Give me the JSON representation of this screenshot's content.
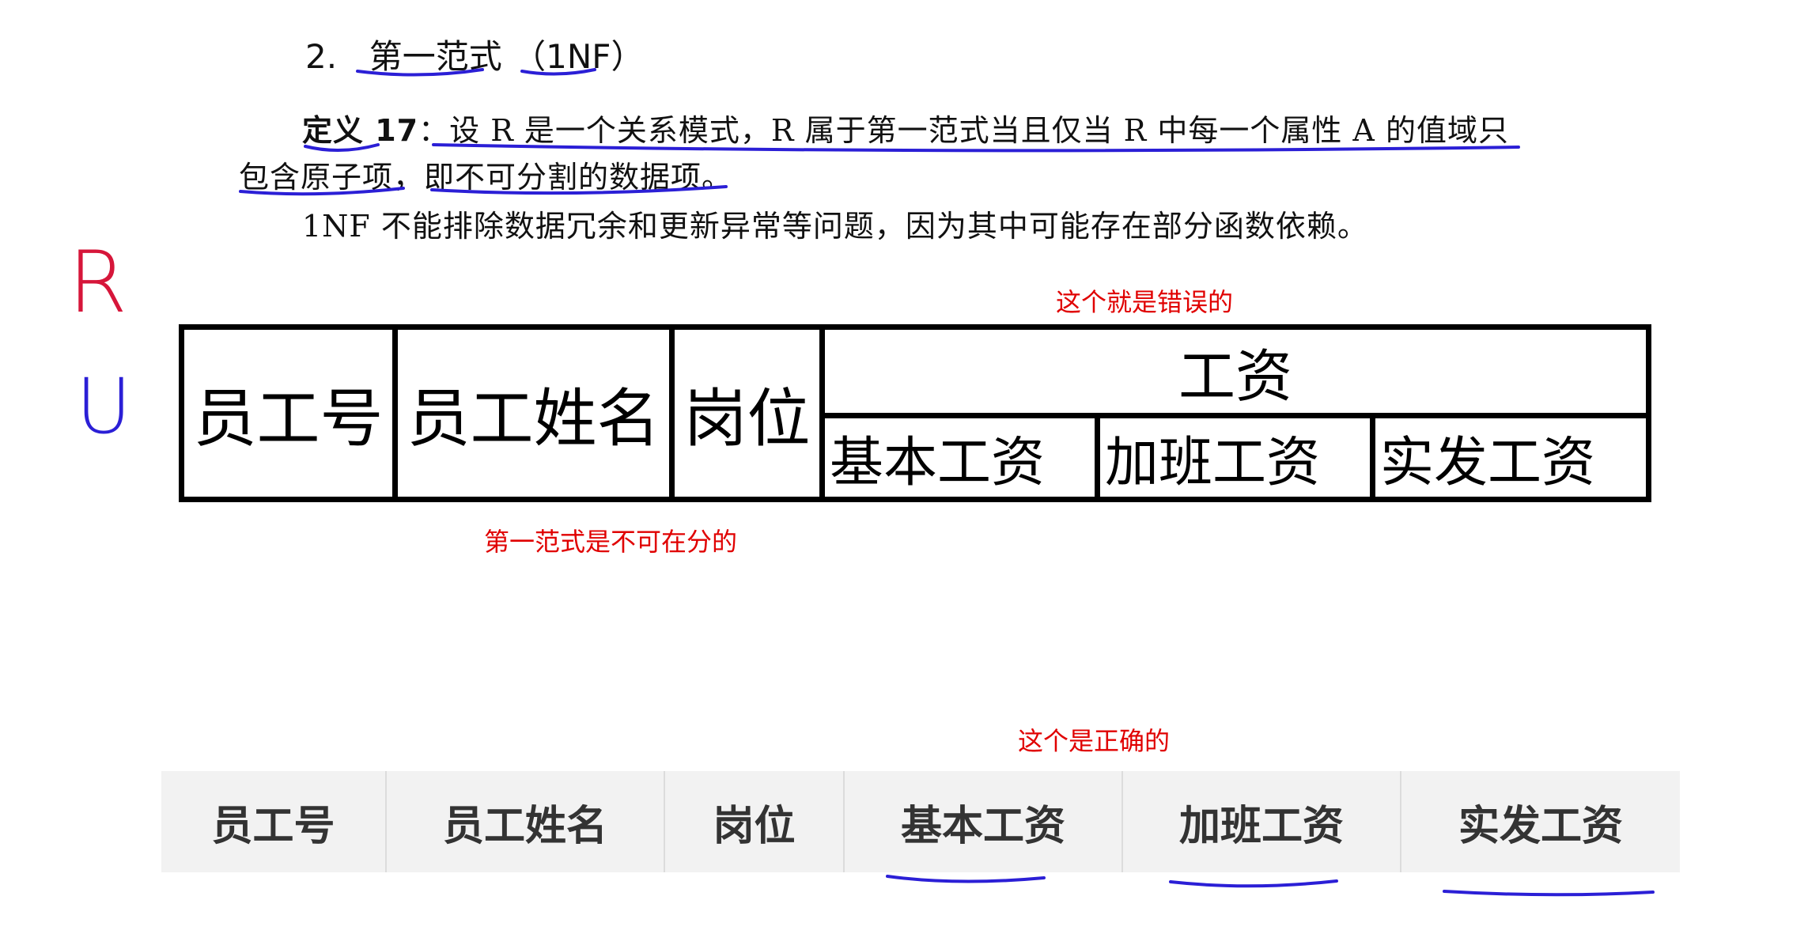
{
  "section": {
    "number": "2.",
    "title": "第一范式",
    "paren": "（1NF）"
  },
  "definition": {
    "label": "定义 17",
    "line1": "：设 R 是一个关系模式，R 属于第一范式当且仅当 R 中每一个属性 A 的值域只",
    "line2": "包含原子项，即不可分割的数据项。",
    "line3": "1NF 不能排除数据冗余和更新异常等问题，因为其中可能存在部分函数依赖。"
  },
  "handwritten": {
    "letter_r": "R",
    "letter_u": "U",
    "ink_color": "#2b1fd6",
    "r_color": "#d6163a"
  },
  "notes": {
    "wrong": "这个就是错误的",
    "atomic": "第一范式是不可在分的",
    "correct": "这个是正确的",
    "color": "#e00000"
  },
  "wrong_table": {
    "col1": "员工号",
    "col2": "员工姓名",
    "col3": "岗位",
    "group": "工资",
    "sub1": "基本工资",
    "sub2": "加班工资",
    "sub3": "实发工资"
  },
  "correct_table": {
    "headers": [
      "员工号",
      "员工姓名",
      "岗位",
      "基本工资",
      "加班工资",
      "实发工资"
    ]
  }
}
